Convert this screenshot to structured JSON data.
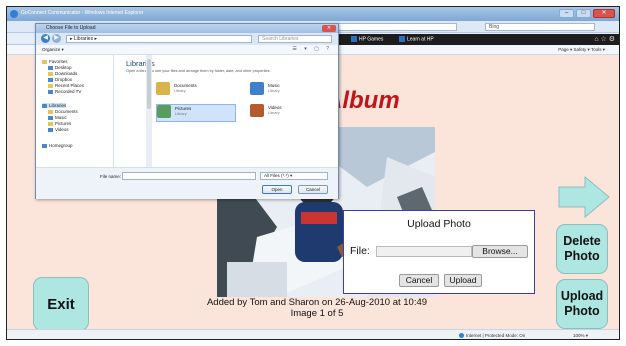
{
  "browser": {
    "window_title": "GoConnect Communicator - Windows Internet Explorer",
    "search_placeholder": "Bing",
    "favorites": [
      "HP Games",
      "Learn at HP"
    ],
    "command_bar": "Page ▾  Safety ▾  Tools ▾",
    "status_zone": "Internet | Protected Mode: On",
    "zoom": "100%"
  },
  "app": {
    "heading": "Album",
    "caption_line1": "Added by Tom and Sharon on 26-Aug-2010 at 10:49",
    "caption_line2": "Image 1 of 5",
    "exit_label": "Exit",
    "delete_label_line1": "Delete",
    "delete_label_line2": "Photo",
    "upload_label_line1": "Upload",
    "upload_label_line2": "Photo",
    "accent_color": "#aee6e2",
    "heading_color": "#c0161a",
    "background_color": "#fbe4da"
  },
  "upload_dialog": {
    "title": "Upload Photo",
    "file_label": "File:",
    "browse_label": "Browse...",
    "cancel_label": "Cancel",
    "upload_label": "Upload"
  },
  "file_dialog": {
    "title": "Choose File to Upload",
    "path": "Libraries",
    "search_placeholder": "Search Libraries",
    "organize_label": "Organize ▾",
    "nav_items": [
      {
        "label": "Favorites",
        "icon": "star-icon"
      },
      {
        "label": "Desktop",
        "icon": "desktop-icon"
      },
      {
        "label": "Downloads",
        "icon": "downloads-icon"
      },
      {
        "label": "Dropbox",
        "icon": "dropbox-icon"
      },
      {
        "label": "Recent Places",
        "icon": "recent-places-icon"
      },
      {
        "label": "Recorded TV",
        "icon": "recorded-tv-icon"
      },
      {
        "label": "Libraries",
        "icon": "libraries-icon"
      },
      {
        "label": "Documents",
        "icon": "documents-icon"
      },
      {
        "label": "Music",
        "icon": "music-icon"
      },
      {
        "label": "Pictures",
        "icon": "pictures-icon"
      },
      {
        "label": "Videos",
        "icon": "videos-icon"
      },
      {
        "label": "Homegroup",
        "icon": "homegroup-icon"
      }
    ],
    "libraries_title": "Libraries",
    "libraries_subtitle": "Open a library to see your files and arrange them by folder, date, and other properties.",
    "libraries": [
      {
        "name": "Documents",
        "type": "Library",
        "icon": "documents-library-icon",
        "color": "#d9b44a"
      },
      {
        "name": "Music",
        "type": "Library",
        "icon": "music-library-icon",
        "color": "#3f7fcc"
      },
      {
        "name": "Pictures",
        "type": "Library",
        "icon": "pictures-library-icon",
        "color": "#5a9b5e",
        "selected": true
      },
      {
        "name": "Videos",
        "type": "Library",
        "icon": "videos-library-icon",
        "color": "#b55a2e"
      }
    ],
    "filename_label": "File name:",
    "filter_label": "All Files (*.*)",
    "open_label": "Open",
    "cancel_label": "Cancel"
  }
}
